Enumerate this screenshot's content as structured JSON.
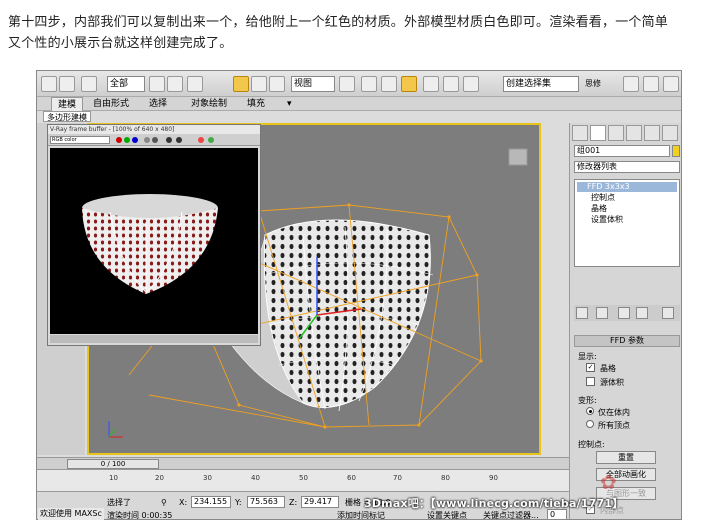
{
  "article": {
    "intro_line1": "第十四步，内部我们可以复制出来一个，给他附上一个红色的材质。外部模型材质白色即可。渲染看看，一个简单",
    "intro_line2": "又个性的小展示台就这样创建完成了。"
  },
  "toolbar": {
    "selection_filter": "全部",
    "view_dropdown": "视图",
    "named_selection": "创建选择集",
    "extra_label": "思修"
  },
  "ribbon": {
    "tabs": [
      "建模",
      "自由形式",
      "选择",
      "对象绘制",
      "填充"
    ],
    "active_tab": "建模",
    "subtab": "多边形建模"
  },
  "frame_buffer": {
    "title": "V-Ray frame buffer - [100% of 640 x 480]",
    "channel": "RGB color"
  },
  "command_panel": {
    "object_name": "组001",
    "modifier_list": "修改器列表",
    "stack": [
      {
        "label": "FFD 3x3x3",
        "selected": true
      },
      {
        "label": "控制点",
        "selected": false
      },
      {
        "label": "晶格",
        "selected": false
      },
      {
        "label": "设置体积",
        "selected": false
      }
    ],
    "rollout_title": "FFD 参数",
    "display_group": "显示:",
    "display_options": [
      {
        "label": "晶格",
        "checked": true
      },
      {
        "label": "源体积",
        "checked": false
      }
    ],
    "deform_group": "变形:",
    "deform_options": [
      {
        "label": "仅在体内",
        "selected": true
      },
      {
        "label": "所有顶点",
        "selected": false
      }
    ],
    "control_group": "控制点:",
    "buttons": [
      {
        "label": "重置",
        "enabled": true
      },
      {
        "label": "全部动画化",
        "enabled": true
      },
      {
        "label": "与图形一致",
        "enabled": false
      }
    ],
    "inner_options": [
      {
        "label": "内部点",
        "checked": true
      },
      {
        "label": "外部点",
        "checked": true
      }
    ]
  },
  "timeline": {
    "slider": "0 / 100",
    "ticks": [
      "10",
      "20",
      "30",
      "40",
      "50",
      "60",
      "70",
      "80",
      "90"
    ]
  },
  "status": {
    "selection": "选择了",
    "x_label": "X:",
    "x_value": "234.155",
    "y_label": "Y:",
    "y_value": "75.563",
    "z_label": "Z:",
    "z_value": "29.417",
    "grid": "栅格 = 10.0",
    "render_time": "渲染时间 0:00:35",
    "add_marker": "添加时间标记",
    "set_key": "设置关键点",
    "key_filters": "关键点过滤器...",
    "frame": "0"
  },
  "dock_label": "欢迎使用 MAXSc",
  "watermark": "3Dmax吧：【www.linecg.com/tieba/1771】",
  "colors": {
    "viewport_border": "#e8c419",
    "lattice": "#f0a020",
    "material_red": "#9a2020"
  }
}
